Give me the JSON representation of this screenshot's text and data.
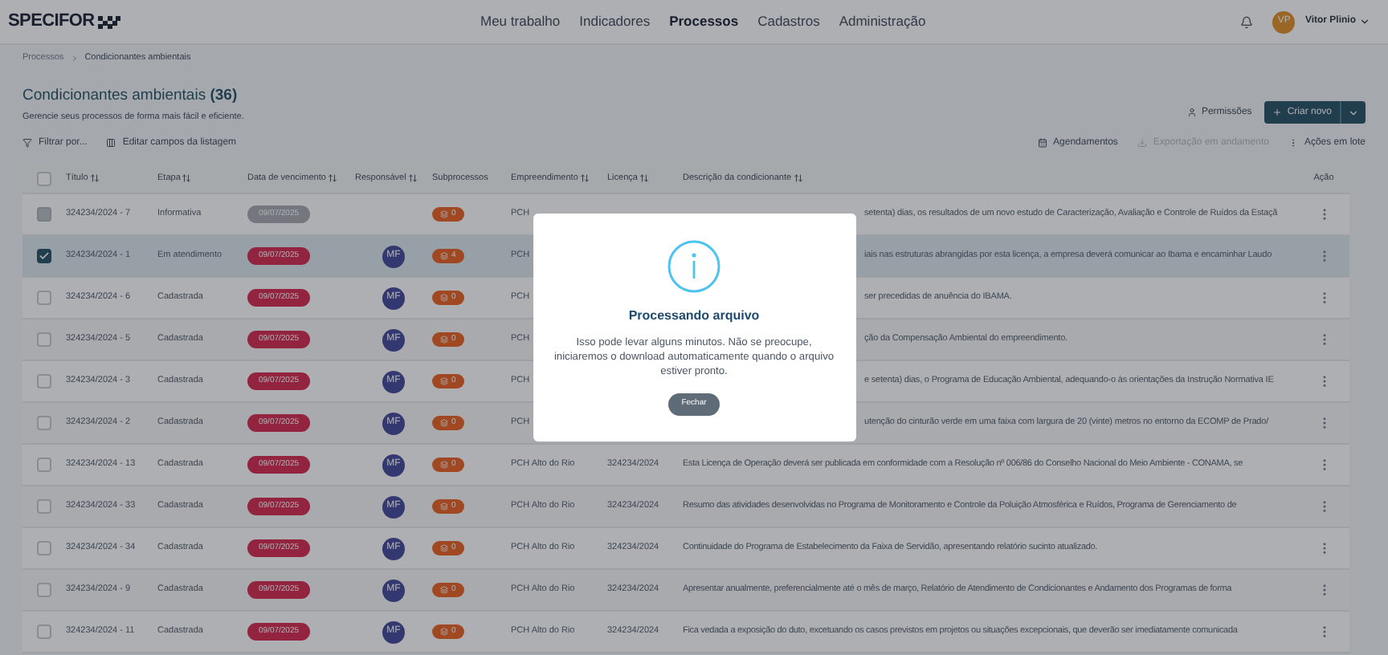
{
  "header": {
    "logo": "SPECIFOR",
    "nav": [
      {
        "label": "Meu trabalho",
        "selected": false
      },
      {
        "label": "Indicadores",
        "selected": false
      },
      {
        "label": "Processos",
        "selected": true
      },
      {
        "label": "Cadastros",
        "selected": false
      },
      {
        "label": "Administração",
        "selected": false
      }
    ],
    "user": {
      "initials": "VP",
      "name": "Vitor Plinio"
    }
  },
  "breadcrumb": [
    "Processos",
    "Condicionantes ambientais"
  ],
  "page": {
    "title": "Condicionantes ambientais **(36)**",
    "subtitle": "Gerencie seus processos de forma mais fácil e eficiente.",
    "permissions": "Permissões",
    "create": "Criar novo"
  },
  "toolbar": {
    "left": [
      "Filtrar por...",
      "Editar campos da listagem"
    ],
    "right": [
      {
        "label": "Agendamentos",
        "disabled": false
      },
      {
        "label": "Exportação em andamento",
        "disabled": true
      },
      {
        "label": "Ações em lote",
        "disabled": false
      }
    ]
  },
  "table": {
    "select_all": {
      "checked": false
    },
    "columns": [
      {
        "label": "Título",
        "sortable": true
      },
      {
        "label": "Etapa",
        "sortable": true
      },
      {
        "label": "Data de vencimento",
        "sortable": true
      },
      {
        "label": "Responsável",
        "sortable": true
      },
      {
        "label": "Subprocessos",
        "sortable": false
      },
      {
        "label": "Empreendimento",
        "sortable": true
      },
      {
        "label": "Licença",
        "sortable": true
      },
      {
        "label": "Descrição da condicionante",
        "sortable": true
      },
      {
        "label": "Ação",
        "sortable": false
      }
    ],
    "rows": [
      {
        "kind": "covered",
        "checked": false,
        "disabled": true,
        "selected": false,
        "titulo": "324234/2024 - 7",
        "etapa": "Informativa",
        "data": "09/07/2025",
        "overdue": false,
        "subprocessos": "0",
        "empreendimento": "PCH",
        "descricao": "setenta) dias, os resultados de um novo estudo de Caracterização, Avaliação e Controle de Ruídos da Estaçã"
      },
      {
        "kind": "covered",
        "checked": true,
        "disabled": false,
        "selected": true,
        "titulo": "324234/2024 - 1",
        "etapa": "Em atendimento",
        "data": "09/07/2025",
        "overdue": true,
        "responsavel": "MF",
        "subprocessos": "4",
        "empreendimento": "PCH",
        "descricao": "iais nas estruturas abrangidas por esta licença, a empresa deverá comunicar ao Ibama e encaminhar Laudo"
      },
      {
        "kind": "covered",
        "checked": false,
        "disabled": false,
        "selected": false,
        "titulo": "324234/2024 - 6",
        "etapa": "Cadastrada",
        "data": "09/07/2025",
        "overdue": true,
        "responsavel": "MF",
        "subprocessos": "0",
        "empreendimento": "PCH",
        "descricao": "ser precedidas de anuência do IBAMA."
      },
      {
        "kind": "covered",
        "checked": false,
        "disabled": false,
        "selected": false,
        "titulo": "324234/2024 - 5",
        "etapa": "Cadastrada",
        "data": "09/07/2025",
        "overdue": true,
        "responsavel": "MF",
        "subprocessos": "0",
        "empreendimento": "PCH",
        "descricao": "ção da Compensação Ambiental do empreendimento."
      },
      {
        "kind": "covered",
        "checked": false,
        "disabled": false,
        "selected": false,
        "titulo": "324234/2024 - 3",
        "etapa": "Cadastrada",
        "data": "09/07/2025",
        "overdue": true,
        "responsavel": "MF",
        "subprocessos": "0",
        "empreendimento": "PCH",
        "descricao": "e setenta) dias, o Programa de Educação Ambiental, adequando-o às orientações da Instrução Normativa IE"
      },
      {
        "kind": "covered",
        "checked": false,
        "disabled": false,
        "selected": false,
        "titulo": "324234/2024 - 2",
        "etapa": "Cadastrada",
        "data": "09/07/2025",
        "overdue": true,
        "responsavel": "MF",
        "subprocessos": "0",
        "empreendimento": "PCH",
        "descricao": "utenção do cinturão verde em uma faixa com largura de 20 (vinte) metros no entorno da ECOMP de Prado/"
      },
      {
        "kind": "full",
        "checked": false,
        "disabled": false,
        "selected": false,
        "titulo": "324234/2024 - 13",
        "etapa": "Cadastrada",
        "data": "09/07/2025",
        "overdue": true,
        "responsavel": "MF",
        "subprocessos": "0",
        "empreendimento": "PCH Alto do Rio",
        "licenca": "324234/2024",
        "descricao": "Esta Licença de Operação deverá ser publicada em conformidade com a Resolução nº 006/86 do Conselho Nacional do Meio Ambiente - CONAMA, se"
      },
      {
        "kind": "full",
        "checked": false,
        "disabled": false,
        "selected": false,
        "titulo": "324234/2024 - 33",
        "etapa": "Cadastrada",
        "data": "09/07/2025",
        "overdue": true,
        "responsavel": "MF",
        "subprocessos": "0",
        "empreendimento": "PCH Alto do Rio",
        "licenca": "324234/2024",
        "descricao": "Resumo das atividades desenvolvidas no Programa de Monitoramento e Controle da Poluição Atmosférica e Ruídos, Programa de Gerenciamento de"
      },
      {
        "kind": "full",
        "checked": false,
        "disabled": false,
        "selected": false,
        "titulo": "324234/2024 - 34",
        "etapa": "Cadastrada",
        "data": "09/07/2025",
        "overdue": true,
        "responsavel": "MF",
        "subprocessos": "0",
        "empreendimento": "PCH Alto do Rio",
        "licenca": "324234/2024",
        "descricao": "Continuidade do Programa de Estabelecimento da Faixa de Servidão, apresentando relatório sucinto atualizado."
      },
      {
        "kind": "full",
        "checked": false,
        "disabled": false,
        "selected": false,
        "titulo": "324234/2024 - 9",
        "etapa": "Cadastrada",
        "data": "09/07/2025",
        "overdue": true,
        "responsavel": "MF",
        "subprocessos": "0",
        "empreendimento": "PCH Alto do Rio",
        "licenca": "324234/2024",
        "descricao": "Apresentar anualmente, preferencialmente até o mês de março, Relatório de Atendimento de Condicionantes e Andamento dos Programas de forma"
      },
      {
        "kind": "full",
        "checked": false,
        "disabled": false,
        "selected": false,
        "titulo": "324234/2024 - 11",
        "etapa": "Cadastrada",
        "data": "09/07/2025",
        "overdue": true,
        "responsavel": "MF",
        "subprocessos": "0",
        "empreendimento": "PCH Alto do Rio",
        "licenca": "324234/2024",
        "descricao": "Fica vedada a exposição do duto, excetuando os casos previstos em projetos ou situações excepcionais, que deverão ser imediatamente comunicada"
      }
    ]
  },
  "modal": {
    "title": "Processando arquivo",
    "message": "Isso pode levar alguns minutos. Não se preocupe, iniciaremos o download automaticamente quando o arquivo estiver pronto.",
    "button": "Fechar"
  }
}
